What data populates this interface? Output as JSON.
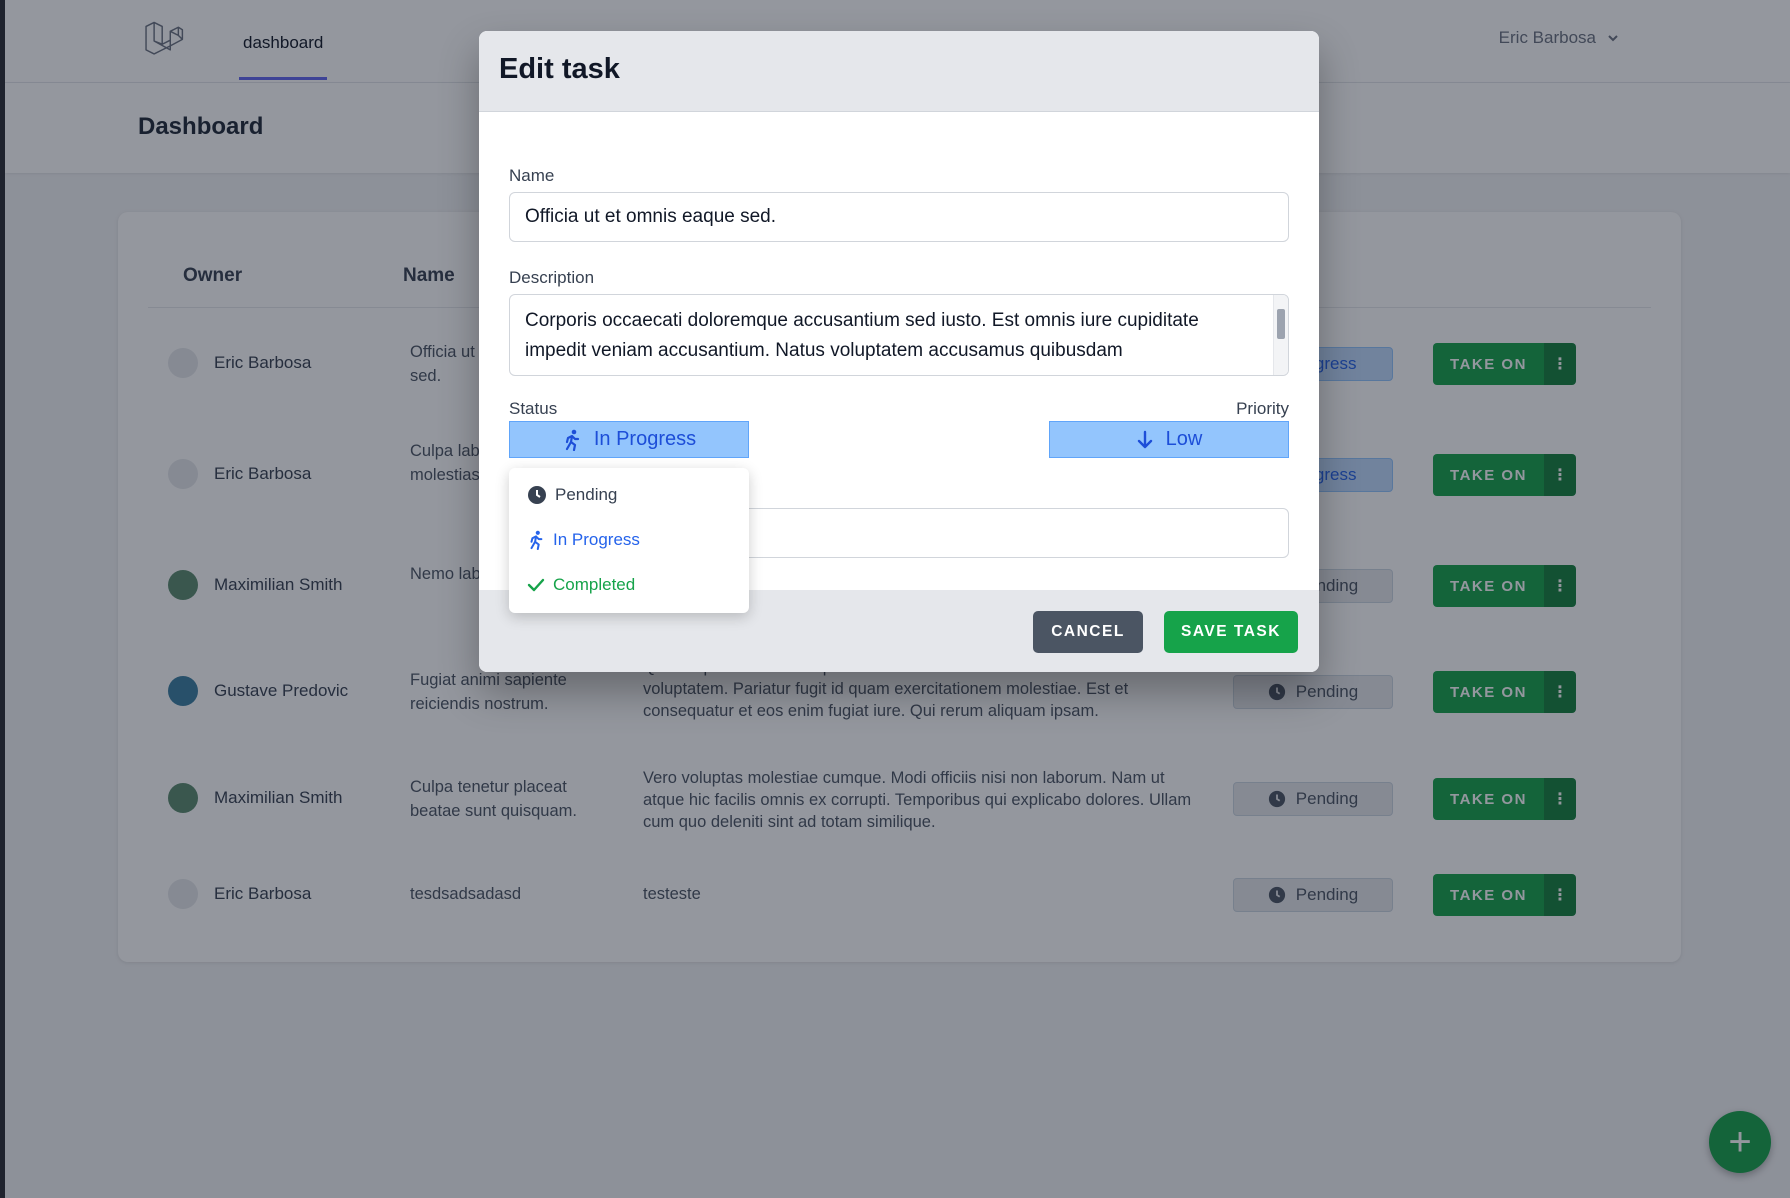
{
  "nav": {
    "logo_icon": "laravel-logo-icon",
    "link": "dashboard",
    "user": "Eric Barbosa"
  },
  "header": {
    "title": "Dashboard"
  },
  "table": {
    "columns": [
      "Owner",
      "Name"
    ],
    "rows": [
      {
        "owner": "Eric Barbosa",
        "name": "Officia ut et omnis eaque sed.",
        "description": "",
        "status": "In Progress",
        "action": "TAKE ON",
        "avatar_color": "#e5e7eb"
      },
      {
        "owner": "Eric Barbosa",
        "name": "Culpa laboriosam molestias voluptatem.",
        "description": "",
        "status": "In Progress",
        "action": "TAKE ON",
        "avatar_color": "#e5e7eb"
      },
      {
        "owner": "Maximilian Smith",
        "name": "Nemo laborum labore.",
        "description": "",
        "status": "Pending",
        "action": "TAKE ON",
        "avatar_color": "#5b8a6e"
      },
      {
        "owner": "Gustave Predovic",
        "name": "Fugiat animi sapiente reiciendis nostrum.",
        "description": "Qui voluptatem dolores quidem dolores architecto nostrum error voluptatem. Pariatur fugit id quam exercitationem molestiae. Est et consequatur et eos enim fugiat iure. Qui rerum aliquam ipsam.",
        "status": "Pending",
        "action": "TAKE ON",
        "avatar_color": "#3b7ea1"
      },
      {
        "owner": "Maximilian Smith",
        "name": "Culpa tenetur placeat beatae sunt quisquam.",
        "description": "Vero voluptas molestiae cumque. Modi officiis nisi non laborum. Nam ut atque hic facilis omnis ex corrupti. Temporibus qui explicabo dolores. Ullam cum quo deleniti sint ad totam similique.",
        "status": "Pending",
        "action": "TAKE ON",
        "avatar_color": "#5b8a6e"
      },
      {
        "owner": "Eric Barbosa",
        "name": "tesdsadsadasd",
        "description": "testeste",
        "status": "Pending",
        "action": "TAKE ON",
        "avatar_color": "#e5e7eb"
      }
    ]
  },
  "modal": {
    "title": "Edit task",
    "name_label": "Name",
    "name_value": "Officia ut et omnis eaque sed.",
    "description_label": "Description",
    "description_value": "Corporis occaecati doloremque accusantium sed iusto. Est omnis iure cupiditate impedit veniam accusantium. Natus voluptatem accusamus quibusdam",
    "status_label": "Status",
    "status_value": "In Progress",
    "priority_label": "Priority",
    "priority_value": "Low",
    "status_options": [
      {
        "label": "Pending",
        "icon": "clock-icon",
        "color": "#374151"
      },
      {
        "label": "In Progress",
        "icon": "running-icon",
        "color": "#2563eb"
      },
      {
        "label": "Completed",
        "icon": "check-icon",
        "color": "#16a34a"
      }
    ],
    "cancel_label": "CANCEL",
    "save_label": "SAVE TASK"
  },
  "colors": {
    "accent_green": "#16a34a",
    "accent_blue": "#93c5fd",
    "cancel_gray": "#4b5563"
  }
}
